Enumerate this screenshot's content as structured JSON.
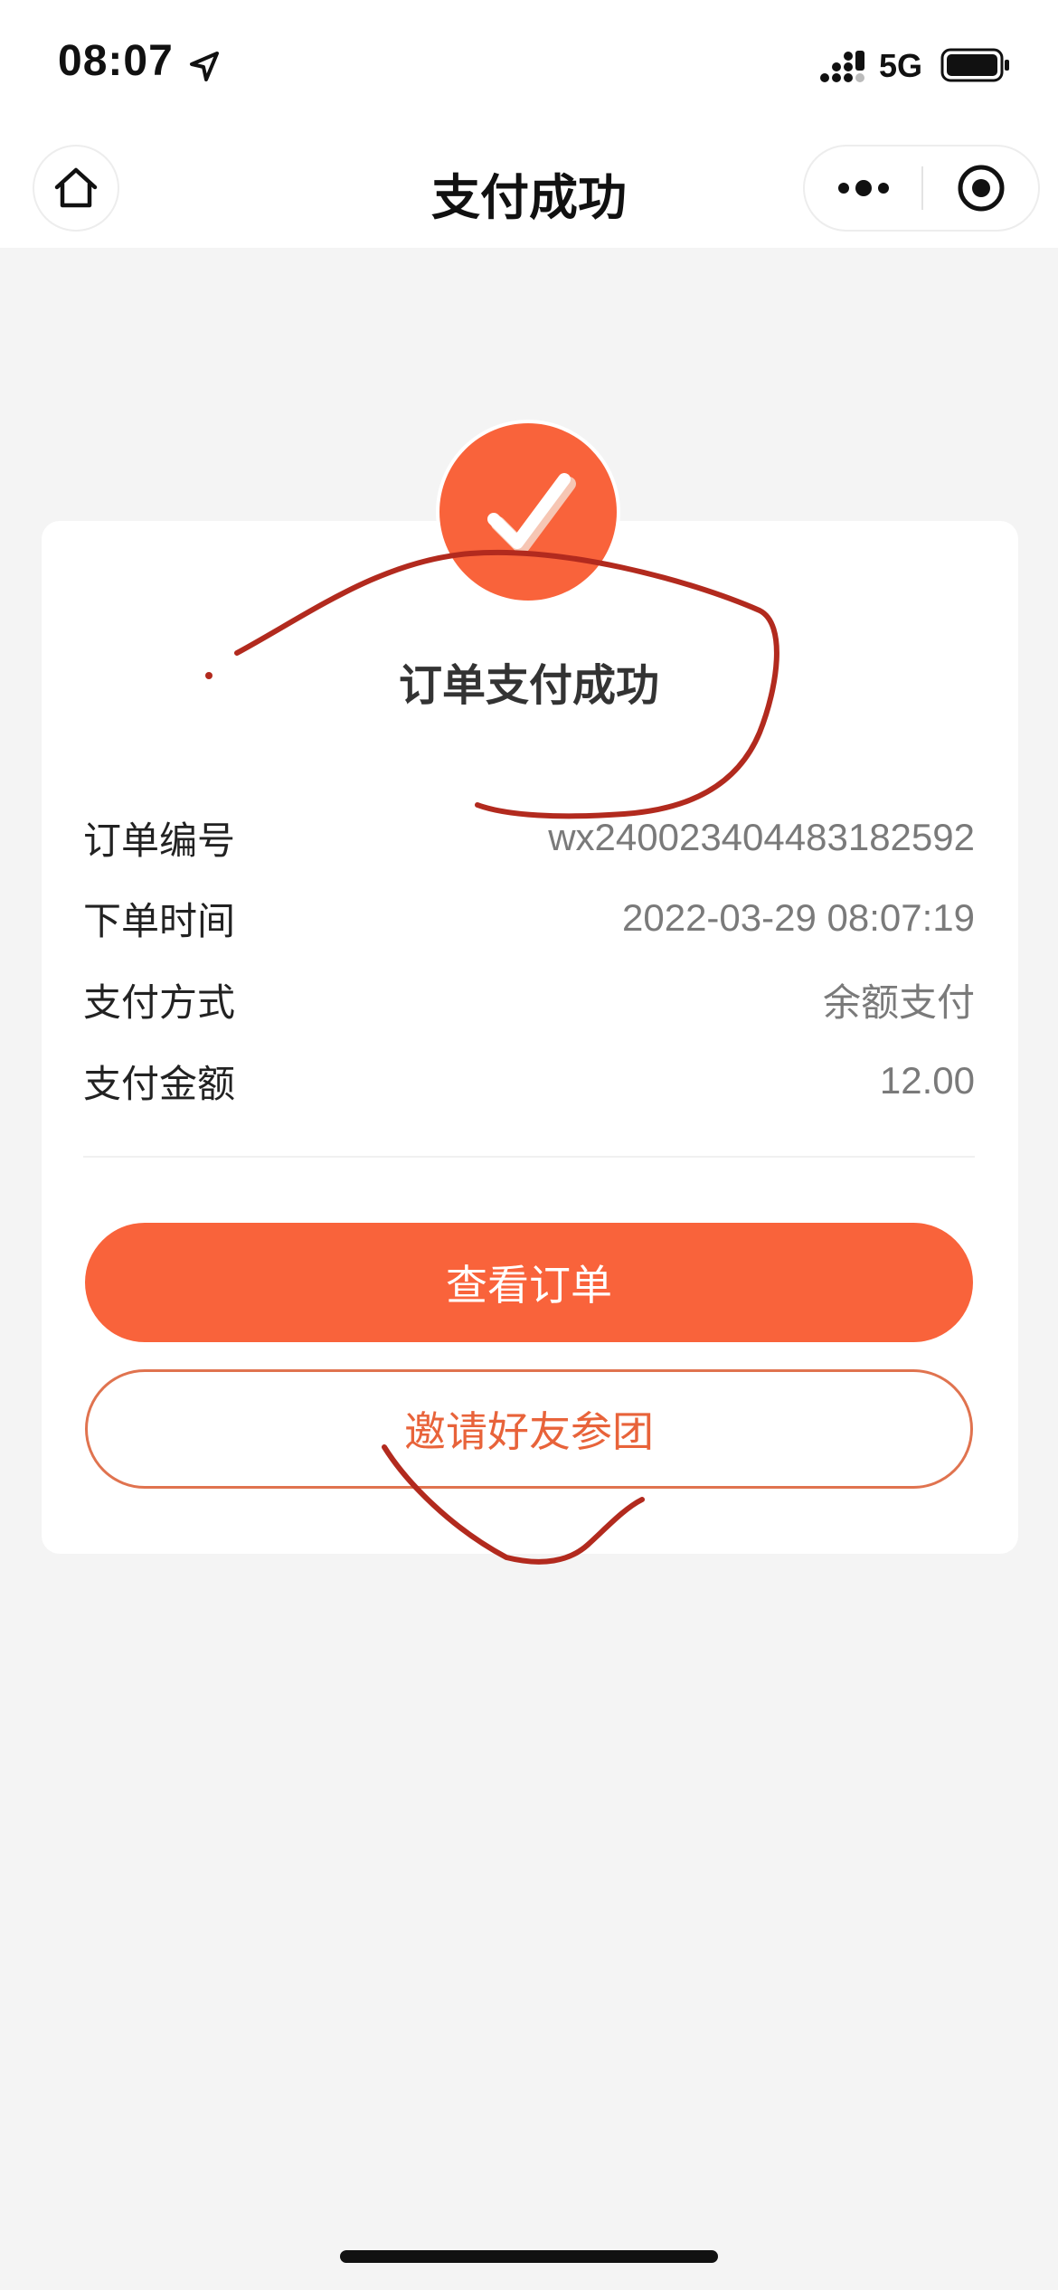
{
  "status_bar": {
    "time": "08:07",
    "network": "5G",
    "location_icon": "location-arrow-icon",
    "signal_icon": "cellular-signal-icon",
    "battery_icon": "battery-icon"
  },
  "nav": {
    "title": "支付成功",
    "home_icon": "home-icon",
    "more_icon": "more-dots-icon",
    "close_icon": "close-circle-icon"
  },
  "result": {
    "icon": "check-icon",
    "title": "订单支付成功"
  },
  "order_info": [
    {
      "label": "订单编号",
      "value": "wx2400234044831825​92"
    },
    {
      "label": "下单时间",
      "value": "2022-03-29 08:07:19"
    },
    {
      "label": "支付方式",
      "value": "余额支付"
    },
    {
      "label": "支付金额",
      "value": "12.00"
    }
  ],
  "actions": {
    "view_order": "查看订单",
    "invite_friends": "邀请好友参团"
  },
  "colors": {
    "accent": "#f9633b",
    "background": "#f4f4f4",
    "annotation": "#b22a1e"
  }
}
